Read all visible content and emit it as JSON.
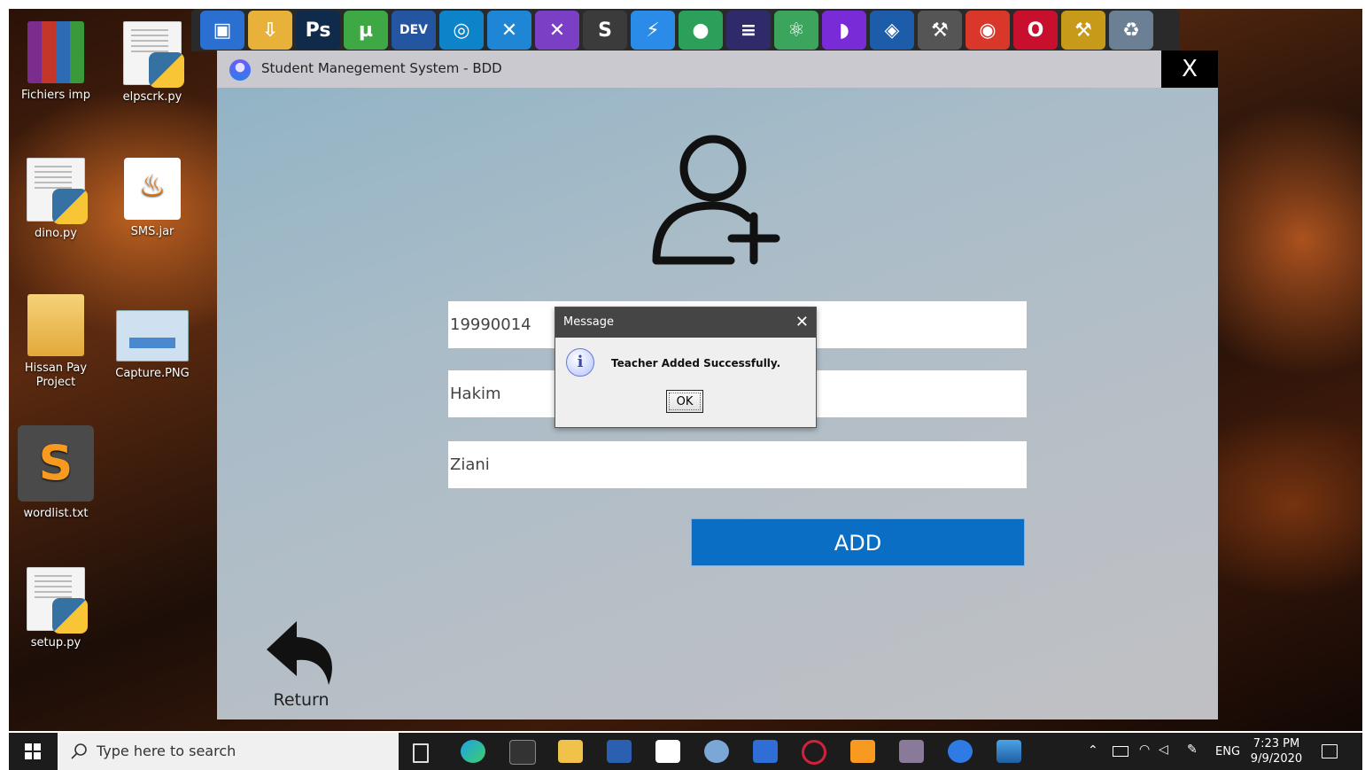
{
  "desktop": {
    "icons": [
      {
        "label": "Fichiers imp"
      },
      {
        "label": "elpscrk.py"
      },
      {
        "label": "dino.py"
      },
      {
        "label": "SMS.jar"
      },
      {
        "label": "Hissan Pay Project"
      },
      {
        "label": "Capture.PNG"
      },
      {
        "label": "wordlist.txt"
      },
      {
        "label": "setup.py"
      }
    ]
  },
  "dock": {
    "icons": [
      {
        "glyph": "▣",
        "color": "#2b6fd0"
      },
      {
        "glyph": "⇩",
        "color": "#e8b23a"
      },
      {
        "glyph": "Ps",
        "color": "#0f2a4a"
      },
      {
        "glyph": "µ",
        "color": "#3da844"
      },
      {
        "glyph": "DEV",
        "color": "#2455a0"
      },
      {
        "glyph": "◎",
        "color": "#0d84c9"
      },
      {
        "glyph": "✕",
        "color": "#1f86d6"
      },
      {
        "glyph": "✕",
        "color": "#7b3fc6"
      },
      {
        "glyph": "S",
        "color": "#3b3b3b"
      },
      {
        "glyph": "⚡",
        "color": "#2a8be8"
      },
      {
        "glyph": "●",
        "color": "#2ca05a"
      },
      {
        "glyph": "≡",
        "color": "#2f2a6a"
      },
      {
        "glyph": "⚛",
        "color": "#3ba55d"
      },
      {
        "glyph": "◗",
        "color": "#7a2bd8"
      },
      {
        "glyph": "◈",
        "color": "#1c5ca8"
      },
      {
        "glyph": "⚒",
        "color": "#555555"
      },
      {
        "glyph": "◉",
        "color": "#d9372a"
      },
      {
        "glyph": "O",
        "color": "#c8102e"
      },
      {
        "glyph": "⚒",
        "color": "#c89a1a"
      },
      {
        "glyph": "♻",
        "color": "#6b7f95"
      }
    ]
  },
  "app": {
    "title": "Student Manegement System - BDD",
    "close_label": "X",
    "fields": {
      "id_value": "19990014",
      "first_name_value": "Hakim",
      "last_name_value": "Ziani"
    },
    "add_label": "ADD",
    "return_label": "Return"
  },
  "dialog": {
    "title": "Message",
    "close_glyph": "✕",
    "message": "Teacher Added Successfully.",
    "info_glyph": "i",
    "ok_label": "OK"
  },
  "taskbar": {
    "search_placeholder": "Type here to search",
    "language": "ENG",
    "time": "7:23 PM",
    "date": "9/9/2020"
  },
  "colors": {
    "accent_button": "#0a6fc4",
    "title_bar": "#c9c9cf",
    "dialog_bar": "#454545"
  }
}
